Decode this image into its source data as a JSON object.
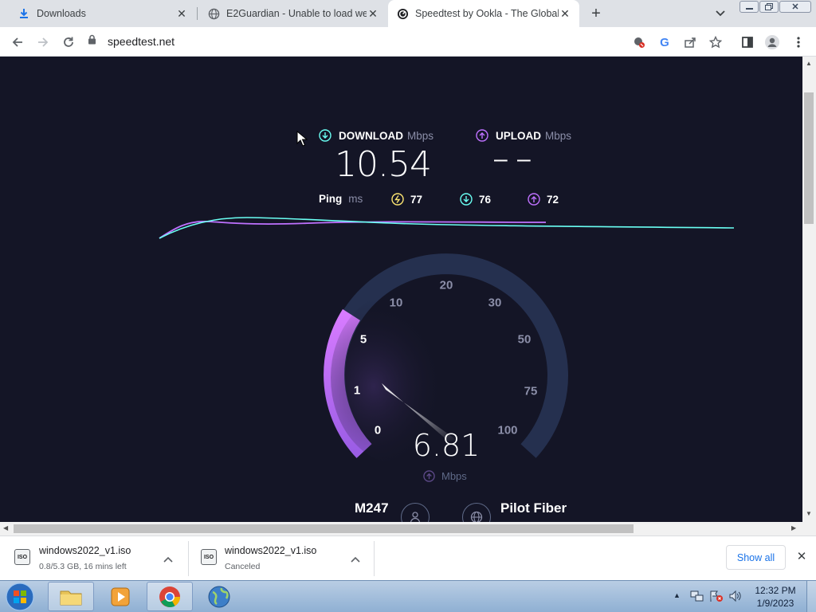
{
  "tabs": [
    {
      "title": "Downloads",
      "icon": "download-icon"
    },
    {
      "title": "E2Guardian - Unable to load web",
      "icon": "globe-icon"
    },
    {
      "title": "Speedtest by Ookla - The Global",
      "icon": "speedtest-icon"
    }
  ],
  "address_bar": {
    "url": "speedtest.net"
  },
  "speedtest": {
    "download_label": "DOWNLOAD",
    "download_unit": "Mbps",
    "download_value": "10.54",
    "upload_label": "UPLOAD",
    "upload_unit": "Mbps",
    "upload_value": "– –",
    "ping_label": "Ping",
    "ping_unit": "ms",
    "ping_idle": "77",
    "ping_down": "76",
    "ping_up": "72",
    "gauge_value": "6.81",
    "gauge_unit": "Mbps",
    "gauge_ticks": [
      "0",
      "1",
      "5",
      "10",
      "20",
      "30",
      "50",
      "75",
      "100"
    ],
    "server_name": "M247",
    "isp_name": "Pilot Fiber",
    "accent_download": "#6afff3",
    "accent_upload": "#bf71ff"
  },
  "downloads": [
    {
      "name": "windows2022_v1.iso",
      "status": "0.8/5.3 GB, 16 mins left"
    },
    {
      "name": "windows2022_v1.iso",
      "status": "Canceled"
    }
  ],
  "downloads_show_all": "Show all",
  "taskbar": {
    "time": "12:32 PM",
    "date": "1/9/2023"
  }
}
